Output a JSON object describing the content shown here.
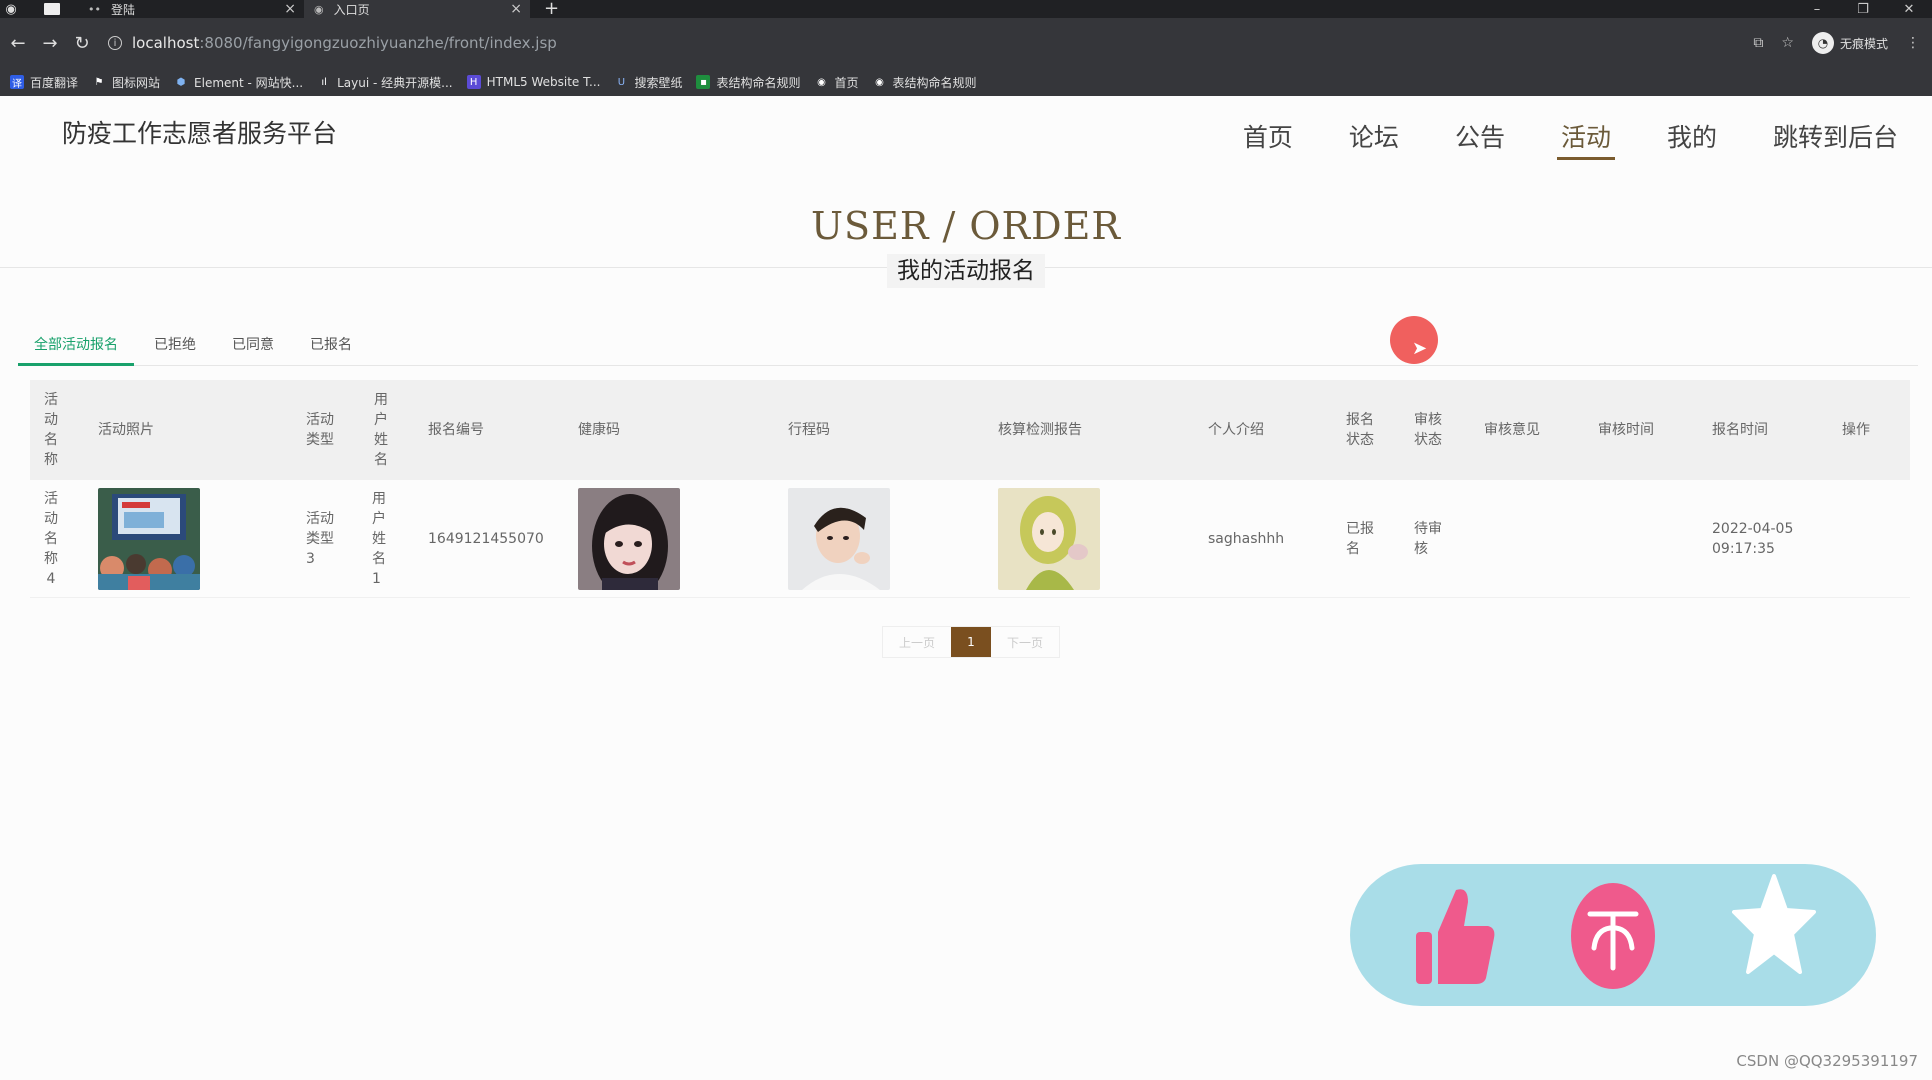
{
  "browser": {
    "tabs": [
      {
        "label": "登陆"
      },
      {
        "label": "入口页"
      }
    ],
    "url_host": "localhost",
    "url_path": ":8080/fangyigongzuozhiyuanzhe/front/index.jsp",
    "profile_label": "无痕模式",
    "bookmarks": [
      {
        "label": "百度翻译",
        "color": "#2f5ee6",
        "glyph": "译"
      },
      {
        "label": "图标网站",
        "color": "#35363a",
        "glyph": "⚑"
      },
      {
        "label": "Element - 网站快...",
        "color": "#4a90e2",
        "glyph": "⬢"
      },
      {
        "label": "Layui - 经典开源模...",
        "color": "#35363a",
        "glyph": "L"
      },
      {
        "label": "HTML5 Website T...",
        "color": "#5b4bd6",
        "glyph": "H"
      },
      {
        "label": "搜索壁纸",
        "color": "#35363a",
        "glyph": "U"
      },
      {
        "label": "表结构命名规则",
        "color": "#1e8e3e",
        "glyph": "■"
      },
      {
        "label": "首页",
        "color": "#35363a",
        "glyph": "◉"
      },
      {
        "label": "表结构命名规则",
        "color": "#35363a",
        "glyph": "◉"
      }
    ]
  },
  "site": {
    "title": "防疫工作志愿者服务平台",
    "nav": [
      "首页",
      "论坛",
      "公告",
      "活动",
      "我的",
      "跳转到后台"
    ],
    "active_nav_index": 3
  },
  "heading": {
    "en": "USER / ORDER",
    "cn": "我的活动报名"
  },
  "tabs": [
    "全部活动报名",
    "已拒绝",
    "已同意",
    "已报名"
  ],
  "table": {
    "headers": {
      "name": "活动名称",
      "photo": "活动照片",
      "type": "活动类型",
      "user": "用户姓名",
      "number": "报名编号",
      "health": "健康码",
      "trip": "行程码",
      "nucleic": "核算检测报告",
      "intro": "个人介绍",
      "apply_status": "报名状态",
      "review_status": "审核状态",
      "review_opinion": "审核意见",
      "review_time": "审核时间",
      "apply_time": "报名时间",
      "op": "操作"
    },
    "rows": [
      {
        "name": "活动名称4",
        "type": "活动类型3",
        "user": "用户姓名1",
        "number": "1649121455070",
        "intro": "saghashhh",
        "apply_status": "已报名",
        "review_status": "待审核",
        "review_opinion": "",
        "review_time": "",
        "apply_time_date": "2022-04-05",
        "apply_time_clock": "09:17:35"
      }
    ]
  },
  "pager": {
    "prev": "上一页",
    "current": "1",
    "next": "下一页"
  },
  "watermark": "CSDN @QQ3295391197",
  "colors": {
    "accent": "#6b5a3a",
    "tab_active": "#18a16b",
    "page_btn": "#7a4f1f",
    "like_panel": "#a9dde8",
    "like_pink": "#ef5a8c"
  }
}
